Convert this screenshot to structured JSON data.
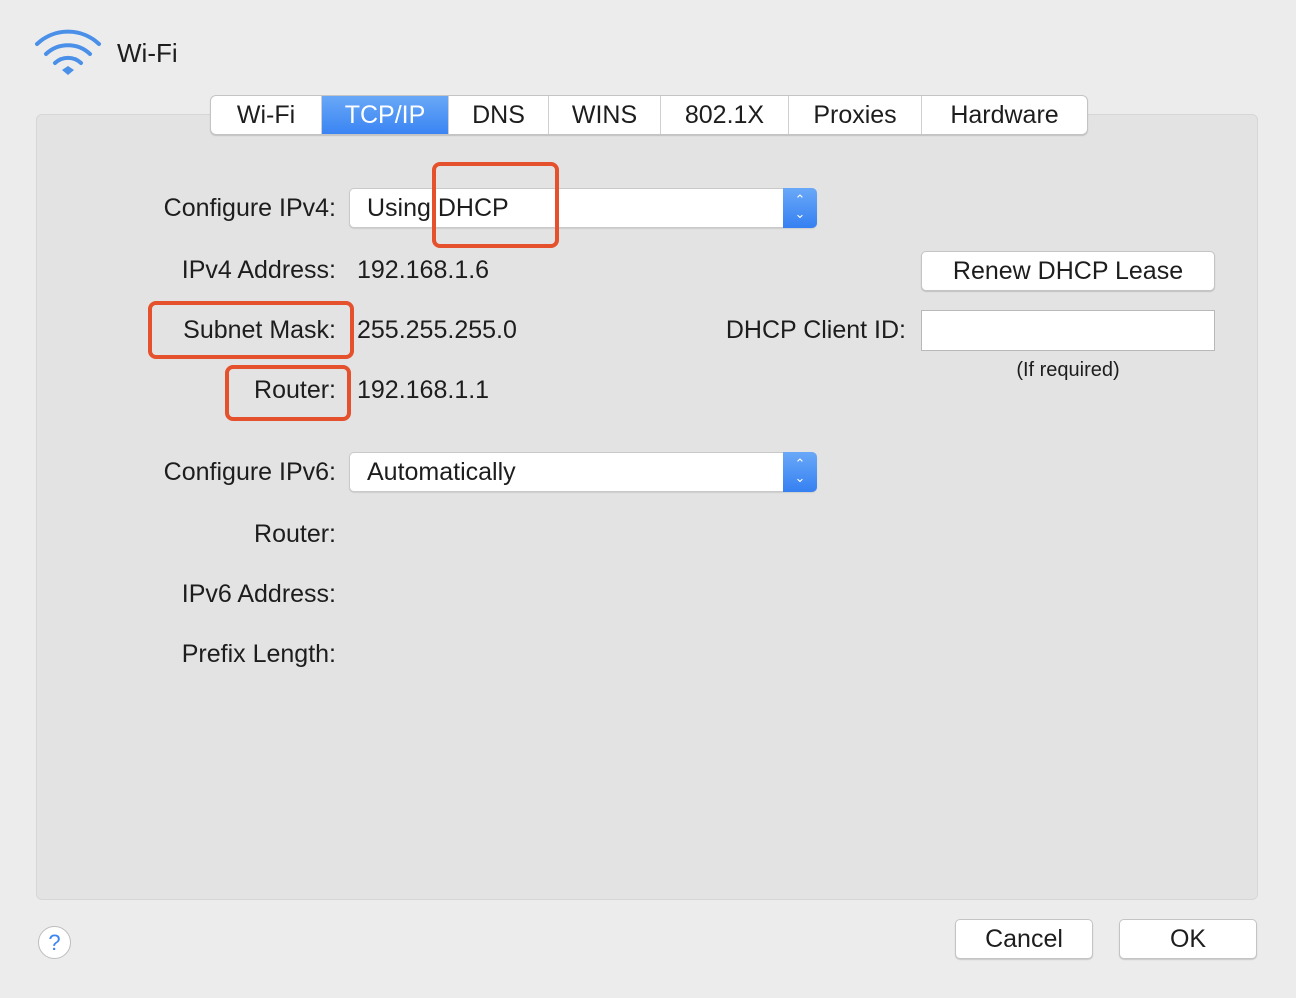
{
  "window": {
    "title": "Wi-Fi",
    "icon": "wifi-icon"
  },
  "tabs": [
    {
      "label": "Wi-Fi"
    },
    {
      "label": "TCP/IP",
      "active": true
    },
    {
      "label": "DNS"
    },
    {
      "label": "WINS"
    },
    {
      "label": "802.1X"
    },
    {
      "label": "Proxies"
    },
    {
      "label": "Hardware"
    }
  ],
  "ipv4": {
    "configure_label": "Configure IPv4:",
    "configure_value": "Using DHCP",
    "address_label": "IPv4 Address:",
    "address": "192.168.1.6",
    "subnet_label": "Subnet Mask:",
    "subnet": "255.255.255.0",
    "router_label": "Router:",
    "router": "192.168.1.1",
    "renew_button": "Renew DHCP Lease",
    "client_id_label": "DHCP Client ID:",
    "client_id_value": "",
    "client_id_hint": "(If required)"
  },
  "ipv6": {
    "configure_label": "Configure IPv6:",
    "configure_value": "Automatically",
    "router_label": "Router:",
    "address_label": "IPv6 Address:",
    "prefix_label": "Prefix Length:"
  },
  "footer": {
    "help": "?",
    "cancel": "Cancel",
    "ok": "OK"
  },
  "colors": {
    "accent": "#3a84f3",
    "annotation": "#e4512c"
  }
}
